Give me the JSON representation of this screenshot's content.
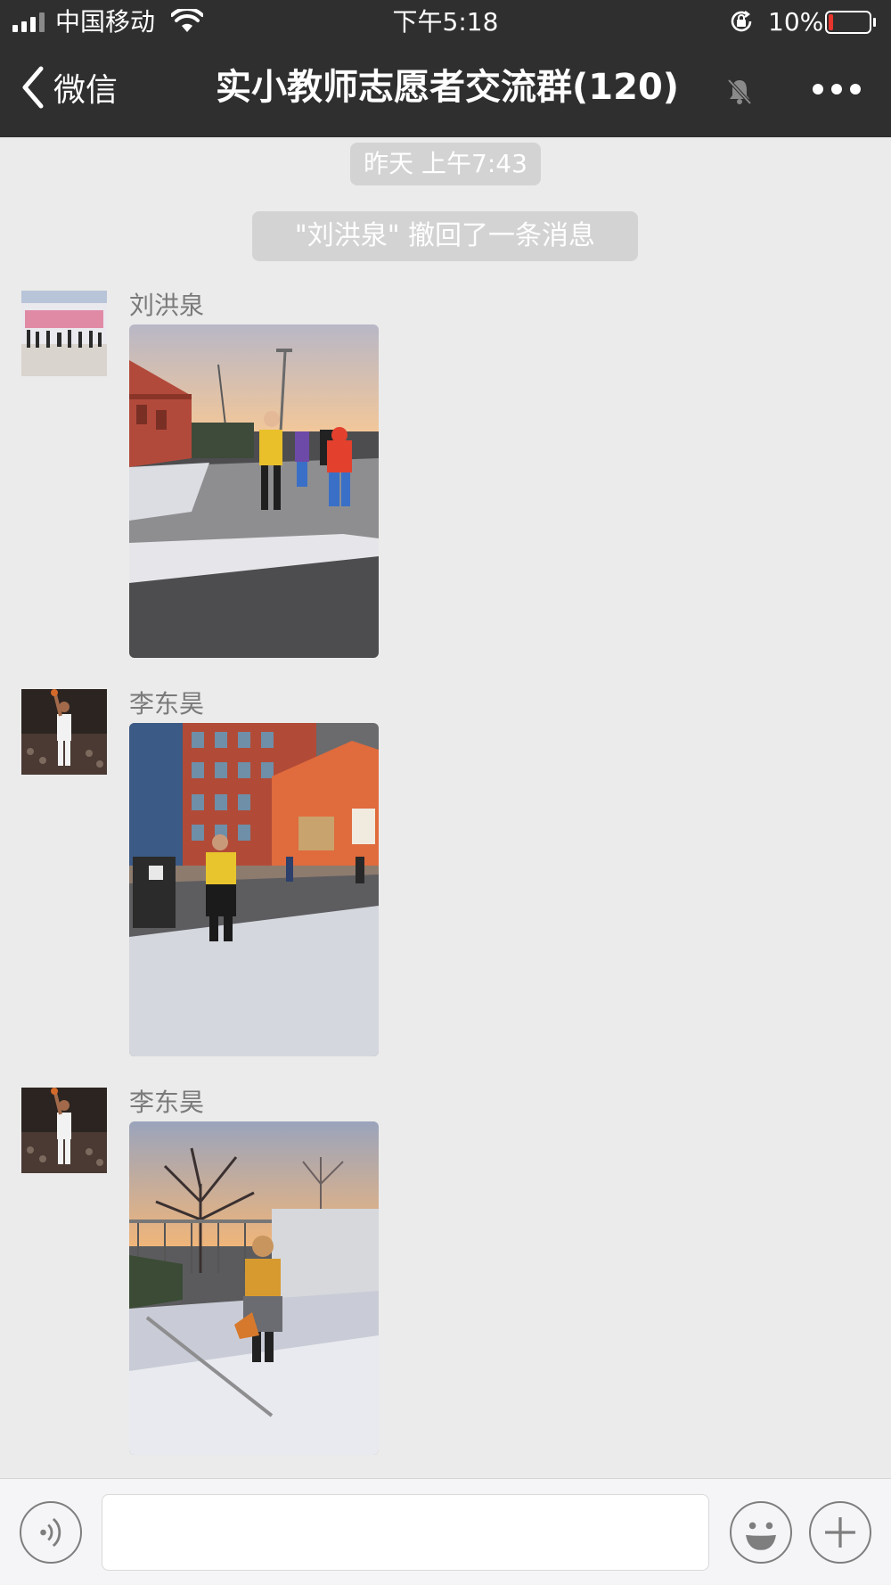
{
  "status_bar": {
    "carrier": "中国移动",
    "time": "下午5:18",
    "battery_percent": "10%",
    "battery_level": 0.1,
    "icons": [
      "signal-icon",
      "wifi-icon",
      "rotation-lock-icon",
      "battery-icon"
    ]
  },
  "nav": {
    "back_label": "微信",
    "title": "实小教师志愿者交流群(120)",
    "icons": [
      "back-chevron-icon",
      "mute-bell-icon",
      "more-icon"
    ]
  },
  "chat": {
    "timestamp": "昨天 上午7:43",
    "recall_notice": "\"刘洪泉\" 撤回了一条消息",
    "messages": [
      {
        "sender": "刘洪泉",
        "type": "image"
      },
      {
        "sender": "李东昊",
        "type": "image"
      },
      {
        "sender": "李东昊",
        "type": "image"
      }
    ]
  },
  "input_bar": {
    "placeholder": "",
    "icons": [
      "voice-icon",
      "emoji-icon",
      "plus-icon"
    ]
  },
  "colors": {
    "header_bg": "#2f2f2f",
    "chat_bg": "#ebebeb",
    "system_bubble": "#d3d3d3",
    "battery_low": "#e5352c"
  }
}
